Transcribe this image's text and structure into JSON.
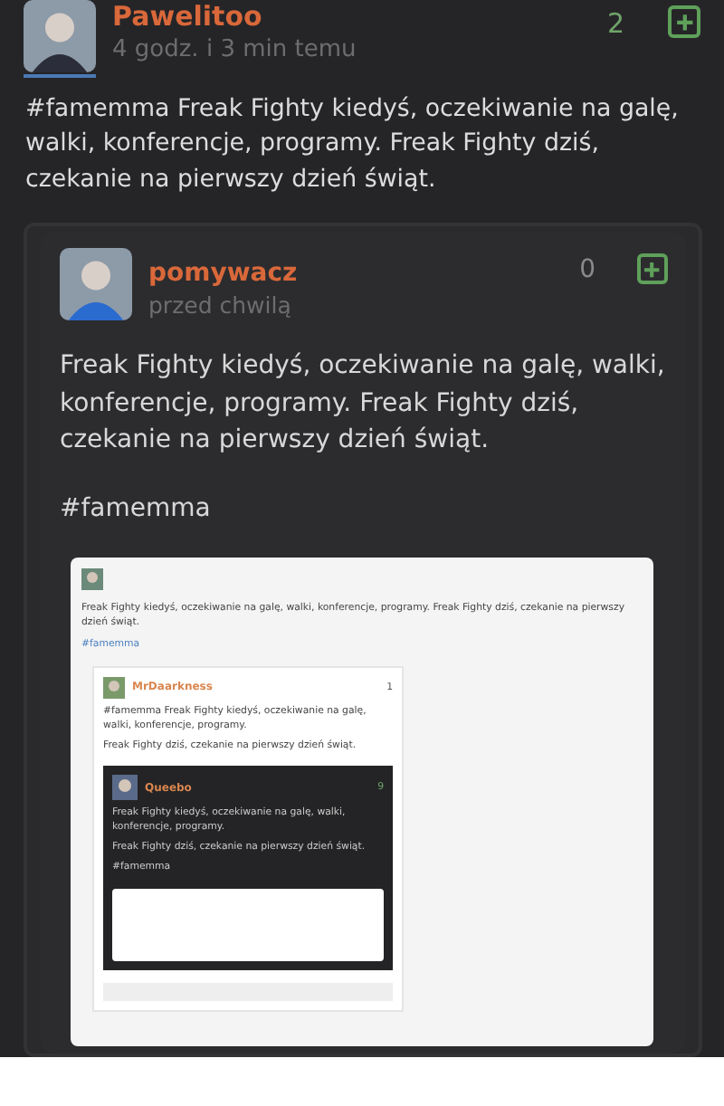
{
  "post": {
    "author": "Pawelitoo",
    "time": "4 godz. i 3 min temu",
    "votes": "2",
    "text": "#famemma Freak Fighty kiedyś, oczekiwanie na galę, walki, konferencje, programy. Freak Fighty dziś, czekanie na pierwszy dzień świąt."
  },
  "embed": {
    "author": "pomywacz",
    "time": "przed chwilą",
    "votes": "0",
    "text": "Freak Fighty kiedyś, oczekiwanie na galę, walki, konferencje, programy. Freak Fighty dziś, czekanie na pierwszy dzień świąt.",
    "hashtag": "#famemma",
    "screenshot": {
      "text": "Freak Fighty kiedyś, oczekiwanie na galę, walki, konferencje, programy. Freak Fighty dziś, czekanie na pierwszy dzień świąt.",
      "hashtag": "#famemma",
      "comment": {
        "author": "MrDaarkness",
        "votes": "1",
        "text": "#famemma Freak Fighty kiedyś, oczekiwanie na galę, walki, konferencje, programy.",
        "text2": "Freak Fighty dziś, czekanie na pierwszy dzień świąt.",
        "reply": {
          "author": "Queebo",
          "votes": "9",
          "text": "Freak Fighty kiedyś, oczekiwanie na galę, walki, konferencje, programy.",
          "text2": "Freak Fighty dziś, czekanie na pierwszy dzień świąt.",
          "hashtag": "#famemma"
        }
      }
    }
  }
}
